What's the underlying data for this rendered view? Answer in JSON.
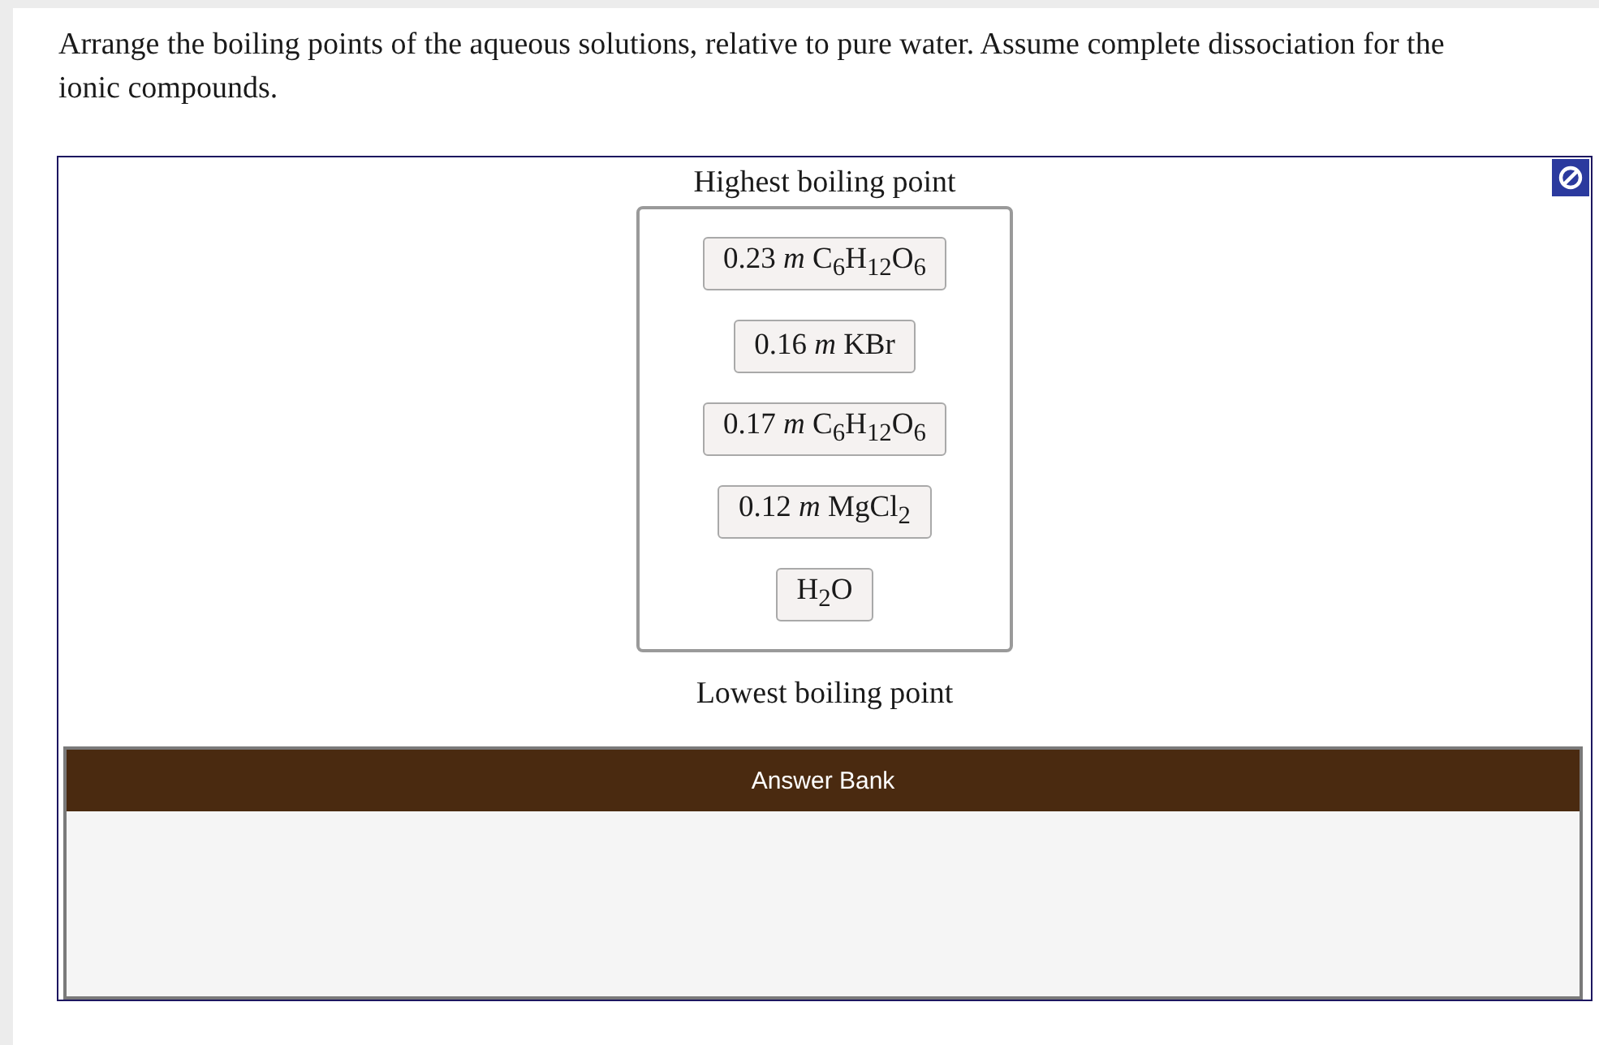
{
  "question": "Arrange the boiling points of the aqueous solutions, relative to pure water. Assume complete dissociation for the ionic compounds.",
  "ranking": {
    "top_label": "Highest boiling point",
    "items": [
      "0.23 *m* C$_{6}$H$_{12}$O$_{6}$",
      "0.16 *m* KBr",
      "0.17 *m* C$_{6}$H$_{12}$O$_{6}$",
      "0.12 *m* MgCl$_{2}$",
      "H$_{2}$O"
    ],
    "bottom_label": "Lowest boiling point"
  },
  "answer_bank": {
    "title": "Answer Bank"
  }
}
